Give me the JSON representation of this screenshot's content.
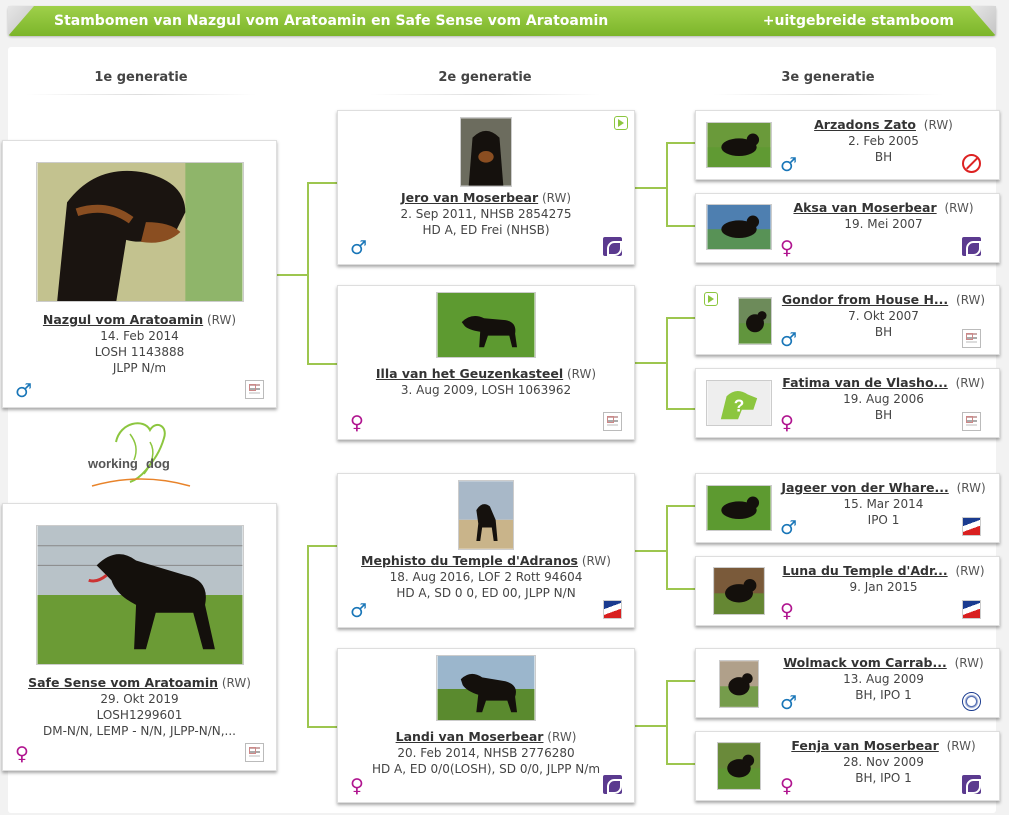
{
  "header": {
    "title": "Stambomen van Nazgul vom Aratoamin en Safe Sense vom Aratoamin",
    "extended_link": "+uitgebreide stamboom"
  },
  "generations": [
    "1e generatie",
    "2e generatie",
    "3e generatie"
  ],
  "logo": {
    "word1": "working",
    "word2": "dog"
  },
  "colors": {
    "accent": "#8cc63f",
    "male": "#1976b8",
    "female": "#b0148f",
    "header_green": "#7cb52a"
  },
  "gen1": [
    {
      "name": "Nazgul vom Aratoamin",
      "reg": "(RW)",
      "lines": [
        "14. Feb 2014",
        "LOSH 1143888",
        "JLPP N/m"
      ],
      "sex": "♂",
      "sex_class": "male",
      "club_icon": "document-icon"
    },
    {
      "name": "Safe Sense vom Aratoamin",
      "reg": "(RW)",
      "lines": [
        "29. Okt 2019",
        "LOSH1299601",
        "DM-N/N, LEMP - N/N, JLPP-N/N,..."
      ],
      "sex": "♀",
      "sex_class": "female",
      "club_icon": "document-icon"
    }
  ],
  "gen2": [
    {
      "name": "Jero van Moserbear",
      "reg": "(RW)",
      "lines": [
        "2. Sep 2011, NHSB 2854275",
        "HD A, ED Frei (NHSB)"
      ],
      "sex": "♂",
      "sex_class": "male",
      "club_icon": "purple-club-icon",
      "video": true
    },
    {
      "name": "Illa van het Geuzenkasteel",
      "reg": "(RW)",
      "lines": [
        "3. Aug 2009, LOSH 1063962"
      ],
      "sex": "♀",
      "sex_class": "female",
      "club_icon": "document-icon",
      "video": false
    },
    {
      "name": "Mephisto du Temple d'Adranos",
      "reg": "(RW)",
      "lines": [
        "18. Aug 2016, LOF 2 Rott 94604",
        "HD A, SD 0 0, ED 00, JLPP N/N"
      ],
      "sex": "♂",
      "sex_class": "male",
      "club_icon": "flag-club-icon",
      "video": false
    },
    {
      "name": "Landi van Moserbear",
      "reg": "(RW)",
      "lines": [
        "20. Feb 2014, NHSB 2776280",
        "HD A, ED 0/0(LOSH), SD 0/0, JLPP N/m"
      ],
      "sex": "♀",
      "sex_class": "female",
      "club_icon": "purple-club-icon",
      "video": false
    }
  ],
  "gen3": [
    {
      "name": "Arzadons Zato",
      "reg": "(RW)",
      "lines": [
        "2. Feb 2005",
        "BH"
      ],
      "sex": "♂",
      "sex_class": "male",
      "club_icon": "no-entry-icon",
      "video": false
    },
    {
      "name": "Aksa van Moserbear",
      "reg": "(RW)",
      "lines": [
        "19. Mei 2007"
      ],
      "sex": "♀",
      "sex_class": "female",
      "club_icon": "purple-club-icon",
      "video": false
    },
    {
      "name": "Gondor from House H...",
      "reg": "(RW)",
      "lines": [
        "7. Okt 2007",
        "BH"
      ],
      "sex": "♂",
      "sex_class": "male",
      "club_icon": "document-icon",
      "video": true
    },
    {
      "name": "Fatima van de Vlasho...",
      "reg": "(RW)",
      "lines": [
        "19. Aug 2006",
        "BH"
      ],
      "sex": "♀",
      "sex_class": "female",
      "club_icon": "document-icon",
      "video": false
    },
    {
      "name": "Jageer von der Whare...",
      "reg": "(RW)",
      "lines": [
        "15. Mar 2014",
        "IPO 1"
      ],
      "sex": "♂",
      "sex_class": "male",
      "club_icon": "flag-club-icon",
      "video": false
    },
    {
      "name": "Luna du Temple d'Adr...",
      "reg": "(RW)",
      "lines": [
        "9. Jan 2015"
      ],
      "sex": "♀",
      "sex_class": "female",
      "club_icon": "flag-club-icon",
      "video": false
    },
    {
      "name": "Wolmack vom Carrab...",
      "reg": "(RW)",
      "lines": [
        "13. Aug 2009",
        "BH, IPO 1"
      ],
      "sex": "♂",
      "sex_class": "male",
      "club_icon": "circle-club-icon",
      "video": false
    },
    {
      "name": "Fenja van Moserbear",
      "reg": "(RW)",
      "lines": [
        "28. Nov 2009",
        "BH, IPO 1"
      ],
      "sex": "♀",
      "sex_class": "female",
      "club_icon": "purple-club-icon",
      "video": false
    }
  ]
}
